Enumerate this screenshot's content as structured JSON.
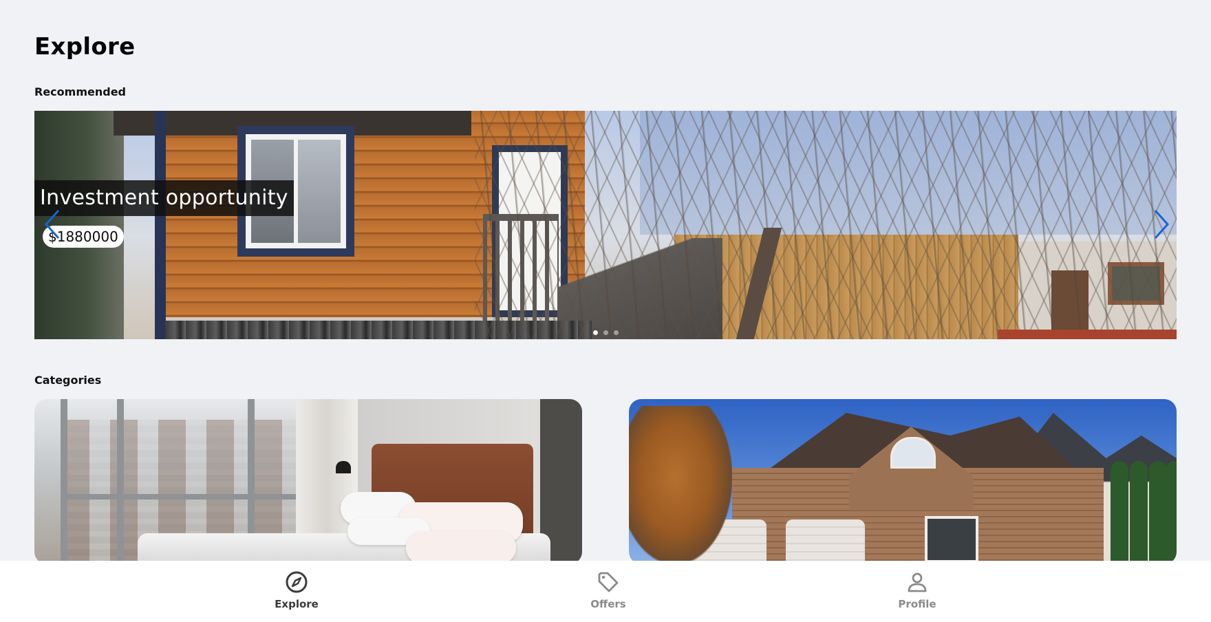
{
  "page": {
    "title": "Explore"
  },
  "sections": {
    "recommended_title": "Recommended",
    "categories_title": "Categories"
  },
  "carousel": {
    "slide_title": "Investment opportunity",
    "slide_price": "$1880000",
    "active_slide_index": 0,
    "slide_count": 3,
    "arrow_color": "#1565d8"
  },
  "categories": [
    {
      "image": "bedroom-photo"
    },
    {
      "image": "brick-house-photo"
    }
  ],
  "nav": {
    "items": [
      {
        "label": "Explore",
        "icon": "compass-icon",
        "active": true
      },
      {
        "label": "Offers",
        "icon": "tag-icon",
        "active": false
      },
      {
        "label": "Profile",
        "icon": "person-icon",
        "active": false
      }
    ]
  }
}
